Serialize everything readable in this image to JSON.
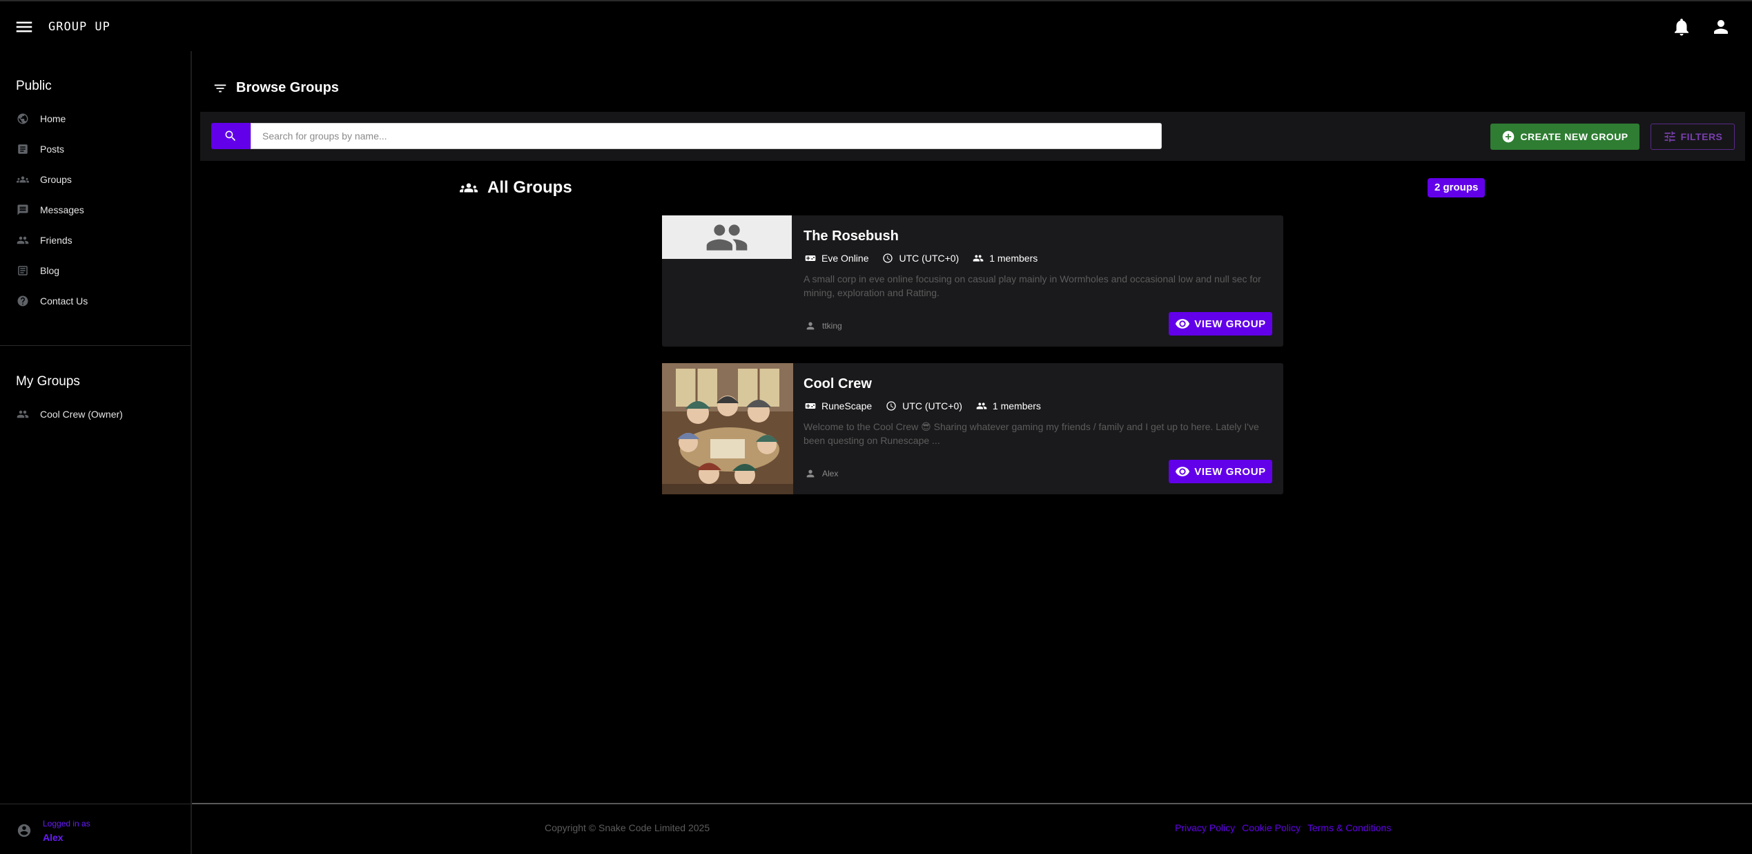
{
  "app": {
    "brand": "GROUP UP"
  },
  "sidebar": {
    "public_title": "Public",
    "public_items": [
      {
        "label": "Home",
        "icon": "globe-icon"
      },
      {
        "label": "Posts",
        "icon": "article-icon"
      },
      {
        "label": "Groups",
        "icon": "groups-icon"
      },
      {
        "label": "Messages",
        "icon": "message-icon"
      },
      {
        "label": "Friends",
        "icon": "people-icon"
      },
      {
        "label": "Blog",
        "icon": "blog-icon"
      },
      {
        "label": "Contact Us",
        "icon": "help-icon"
      }
    ],
    "my_groups_title": "My Groups",
    "my_groups": [
      {
        "label": "Cool Crew (Owner)",
        "icon": "people-icon"
      }
    ],
    "user": {
      "logged_in_label": "Logged in as",
      "name": "Alex"
    }
  },
  "main": {
    "heading": "Browse Groups",
    "search": {
      "placeholder": "Search for groups by name...",
      "value": ""
    },
    "create_button": "CREATE NEW GROUP",
    "filters_button": "FILTERS",
    "all_groups_title": "All Groups",
    "group_count": "2 groups",
    "groups": [
      {
        "name": "The Rosebush",
        "game": "Eve Online",
        "timezone": "UTC (UTC+0)",
        "members": "1 members",
        "description": "A small corp in eve online focusing on casual play mainly in Wormholes and occasional low and null sec for mining, exploration and Ratting.",
        "owner": "ttking",
        "button": "VIEW GROUP",
        "has_image": false
      },
      {
        "name": "Cool Crew",
        "game": "RuneScape",
        "timezone": "UTC (UTC+0)",
        "members": "1 members",
        "description": "Welcome to the Cool Crew 😎 Sharing whatever gaming my friends / family and I get up to here. Lately I've been questing on Runescape ...",
        "owner": "Alex",
        "button": "VIEW GROUP",
        "has_image": true
      }
    ]
  },
  "footer": {
    "copyright": "Copyright © Snake Code Limited 2025",
    "links": [
      "Privacy Policy",
      "Cookie Policy",
      "Terms & Conditions"
    ]
  },
  "colors": {
    "accent": "#6200ea",
    "create": "#2e7d32",
    "card": "#1a1a1c"
  }
}
